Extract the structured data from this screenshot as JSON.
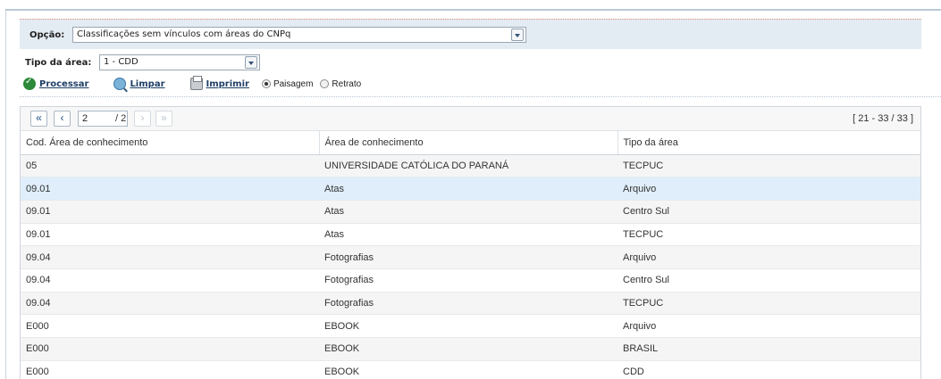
{
  "filters": {
    "opcao_label": "Opção:",
    "opcao_value": "Classificações sem vínculos com áreas do CNPq",
    "tipo_label": "Tipo da área:",
    "tipo_value": "1 - CDD"
  },
  "actions": {
    "processar": "Processar",
    "limpar": "Limpar",
    "imprimir": "Imprimir",
    "paisagem": "Paisagem",
    "retrato": "Retrato",
    "orientation_selected": "Paisagem"
  },
  "pager": {
    "current_page": "2",
    "total_pages": "/ 2",
    "range": "[ 21 - 33 / 33 ]",
    "first": "«",
    "prev": "‹",
    "next": "›",
    "last": "»"
  },
  "table": {
    "columns": [
      "Cod. Área de conhecimento",
      "Área de conhecimento",
      "Tipo da área"
    ],
    "rows": [
      [
        "05",
        "UNIVERSIDADE CATÓLICA DO PARANÁ",
        "TECPUC"
      ],
      [
        "09.01",
        "Atas",
        "Arquivo"
      ],
      [
        "09.01",
        "Atas",
        "Centro Sul"
      ],
      [
        "09.01",
        "Atas",
        "TECPUC"
      ],
      [
        "09.04",
        "Fotografias",
        "Arquivo"
      ],
      [
        "09.04",
        "Fotografias",
        "Centro Sul"
      ],
      [
        "09.04",
        "Fotografias",
        "TECPUC"
      ],
      [
        "E000",
        "EBOOK",
        "Arquivo"
      ],
      [
        "E000",
        "EBOOK",
        "BRASIL"
      ],
      [
        "E000",
        "EBOOK",
        "CDD"
      ]
    ],
    "selected_row_index": 1
  },
  "colors": {
    "filter_bar_bg": "#e3ecf3",
    "selected_row_bg": "#dfeefa",
    "stripe_bg": "#f5f5f5",
    "link_color": "#1e3e66"
  }
}
